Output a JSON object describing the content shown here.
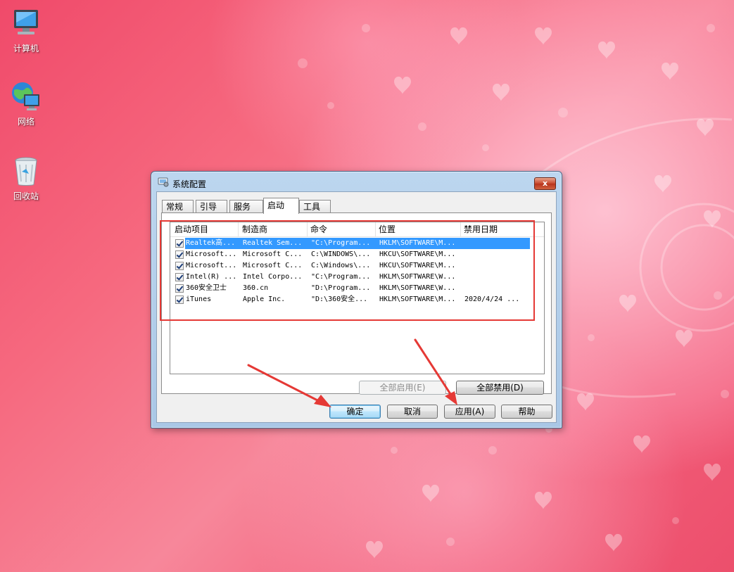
{
  "desktop": {
    "icons": [
      {
        "label": "计算机",
        "icon": "computer-icon"
      },
      {
        "label": "网络",
        "icon": "network-icon"
      },
      {
        "label": "回收站",
        "icon": "recycle-bin-icon"
      }
    ]
  },
  "window": {
    "title": "系统配置",
    "title_icon": "msconfig-icon",
    "close_glyph": "x",
    "tabs": [
      "常规",
      "引导",
      "服务",
      "启动",
      "工具"
    ],
    "active_tab": "启动",
    "columns": [
      "启动项目",
      "制造商",
      "命令",
      "位置",
      "禁用日期"
    ],
    "rows": [
      {
        "checked": true,
        "item": "Realtek高...",
        "maker": "Realtek Sem...",
        "command": "\"C:\\Program...",
        "location": "HKLM\\SOFTWARE\\M...",
        "date": ""
      },
      {
        "checked": true,
        "item": "Microsoft...",
        "maker": "Microsoft C...",
        "command": "C:\\WINDOWS\\...",
        "location": "HKCU\\SOFTWARE\\M...",
        "date": ""
      },
      {
        "checked": true,
        "item": "Microsoft...",
        "maker": "Microsoft C...",
        "command": "C:\\Windows\\...",
        "location": "HKCU\\SOFTWARE\\M...",
        "date": ""
      },
      {
        "checked": true,
        "item": "Intel(R) ...",
        "maker": "Intel Corpo...",
        "command": "\"C:\\Program...",
        "location": "HKLM\\SOFTWARE\\W...",
        "date": ""
      },
      {
        "checked": true,
        "item": "360安全卫士",
        "maker": "360.cn",
        "command": "\"D:\\Program...",
        "location": "HKLM\\SOFTWARE\\W...",
        "date": ""
      },
      {
        "checked": true,
        "item": "iTunes",
        "maker": "Apple Inc.",
        "command": "\"D:\\360安全...",
        "location": "HKLM\\SOFTWARE\\M...",
        "date": "2020/4/24 ..."
      }
    ],
    "enable_all_label": "全部启用(E)",
    "disable_all_label": "全部禁用(D)",
    "ok_label": "确定",
    "cancel_label": "取消",
    "apply_label": "应用(A)",
    "help_label": "帮助"
  },
  "annotations": {
    "highlight_color": "#e53935",
    "arrow_color": "#e53935"
  }
}
